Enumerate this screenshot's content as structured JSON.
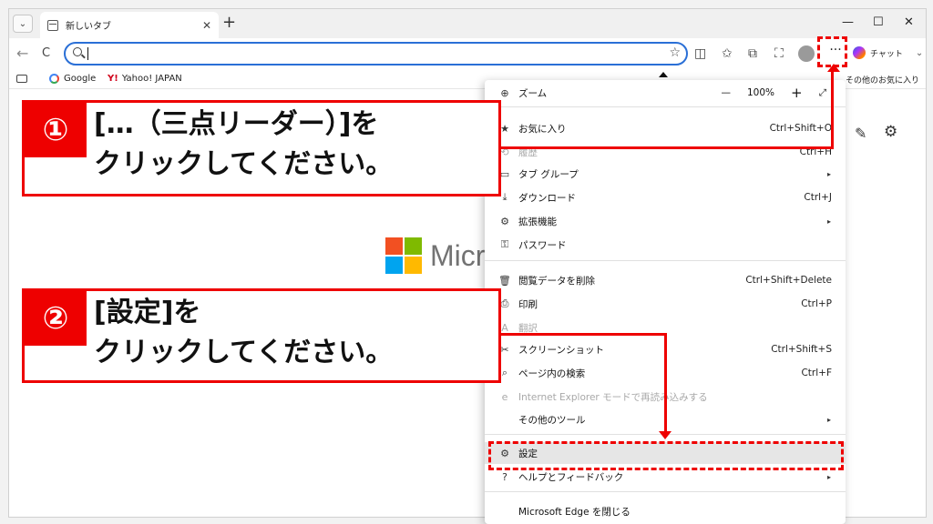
{
  "tab": {
    "label": "新しいタブ",
    "close": "✕"
  },
  "window_controls": {
    "minimize": "—",
    "maximize": "☐",
    "close": "✕"
  },
  "toolbar": {
    "back": "←",
    "reload": "C",
    "more": "···",
    "chat_label": "チャット"
  },
  "bookmarks": [
    {
      "label": "Google"
    },
    {
      "label": "Yahoo! JAPAN"
    }
  ],
  "other_favorites": "その他のお気に入り",
  "page": {
    "logo_text": "Micr"
  },
  "menu": {
    "zoom_label": "ズーム",
    "zoom_value": "100%",
    "zoom_minus": "—",
    "zoom_plus": "+",
    "items": [
      {
        "label": "お気に入り",
        "shortcut": "Ctrl+Shift+O",
        "icon": "★"
      },
      {
        "label": "履歴",
        "shortcut": "Ctrl+H",
        "icon": "⟲"
      },
      {
        "label": "タブ グループ",
        "shortcut": "",
        "icon": "▭",
        "submenu": "▸"
      },
      {
        "label": "ダウンロード",
        "shortcut": "Ctrl+J",
        "icon": "⤓"
      },
      {
        "label": "拡張機能",
        "shortcut": "",
        "icon": "⚙",
        "submenu": "▸"
      },
      {
        "label": "パスワード",
        "shortcut": "",
        "icon": "⚿"
      },
      {
        "label": "閲覧データを削除",
        "shortcut": "Ctrl+Shift+Delete",
        "icon": "🗑"
      },
      {
        "label": "印刷",
        "shortcut": "Ctrl+P",
        "icon": "⎙"
      },
      {
        "label": "翻訳",
        "shortcut": "",
        "icon": "A"
      },
      {
        "label": "スクリーンショット",
        "shortcut": "Ctrl+Shift+S",
        "icon": "✂"
      },
      {
        "label": "ページ内の検索",
        "shortcut": "Ctrl+F",
        "icon": "⌕"
      },
      {
        "label": "Internet Explorer モードで再読み込みする",
        "shortcut": "",
        "icon": "e"
      },
      {
        "label": "その他のツール",
        "shortcut": "",
        "icon": "",
        "submenu": "▸"
      },
      {
        "label": "設定",
        "shortcut": "",
        "icon": "⚙"
      },
      {
        "label": "ヘルプとフィードバック",
        "shortcut": "",
        "icon": "?",
        "submenu": "▸"
      },
      {
        "label": "Microsoft Edge を閉じる",
        "shortcut": "",
        "icon": ""
      }
    ]
  },
  "callouts": {
    "step1": {
      "num": "①",
      "line1": "[…（三点リーダー）]を",
      "line2": "クリックしてください。"
    },
    "step2": {
      "num": "②",
      "line1": "[設定]を",
      "line2": "クリックしてください。"
    }
  }
}
